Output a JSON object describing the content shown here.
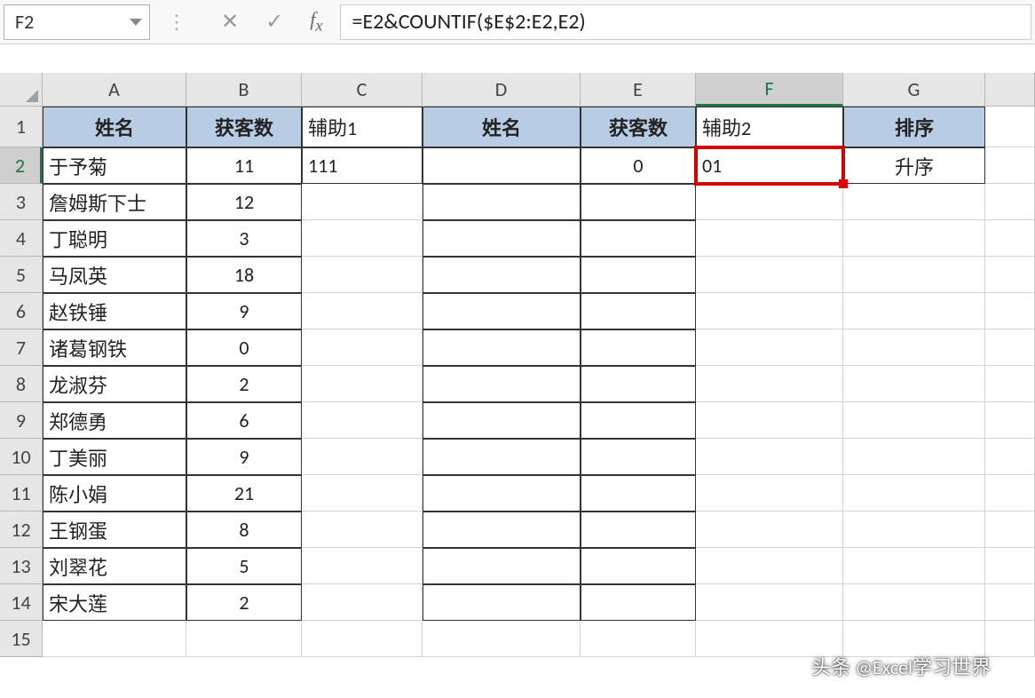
{
  "nameBox": "F2",
  "formula": "=E2&COUNTIF($E$2:E2,E2)",
  "columnLabels": [
    "A",
    "B",
    "C",
    "D",
    "E",
    "F",
    "G"
  ],
  "rowLabels": [
    "1",
    "2",
    "3",
    "4",
    "5",
    "6",
    "7",
    "8",
    "9",
    "10",
    "11",
    "12",
    "13",
    "14",
    "15"
  ],
  "activeCol": "F",
  "activeRow": "2",
  "headers": {
    "A": "姓名",
    "B": "获客数",
    "C": "辅助1",
    "D": "姓名",
    "E": "获客数",
    "F": "辅助2",
    "G": "排序"
  },
  "data": [
    {
      "A": "于予菊",
      "B": "11",
      "C": "111",
      "D": "",
      "E": "0",
      "F": "01",
      "G": "升序"
    },
    {
      "A": "詹姆斯下士",
      "B": "12"
    },
    {
      "A": "丁聪明",
      "B": "3"
    },
    {
      "A": "马凤英",
      "B": "18"
    },
    {
      "A": "赵铁锤",
      "B": "9"
    },
    {
      "A": "诸葛钢铁",
      "B": "0"
    },
    {
      "A": "龙淑芬",
      "B": "2"
    },
    {
      "A": "郑德勇",
      "B": "6"
    },
    {
      "A": "丁美丽",
      "B": "9"
    },
    {
      "A": "陈小娟",
      "B": "21"
    },
    {
      "A": "王钢蛋",
      "B": "8"
    },
    {
      "A": "刘翠花",
      "B": "5"
    },
    {
      "A": "宋大莲",
      "B": "2"
    }
  ],
  "watermark": "头条 @Excel学习世界"
}
